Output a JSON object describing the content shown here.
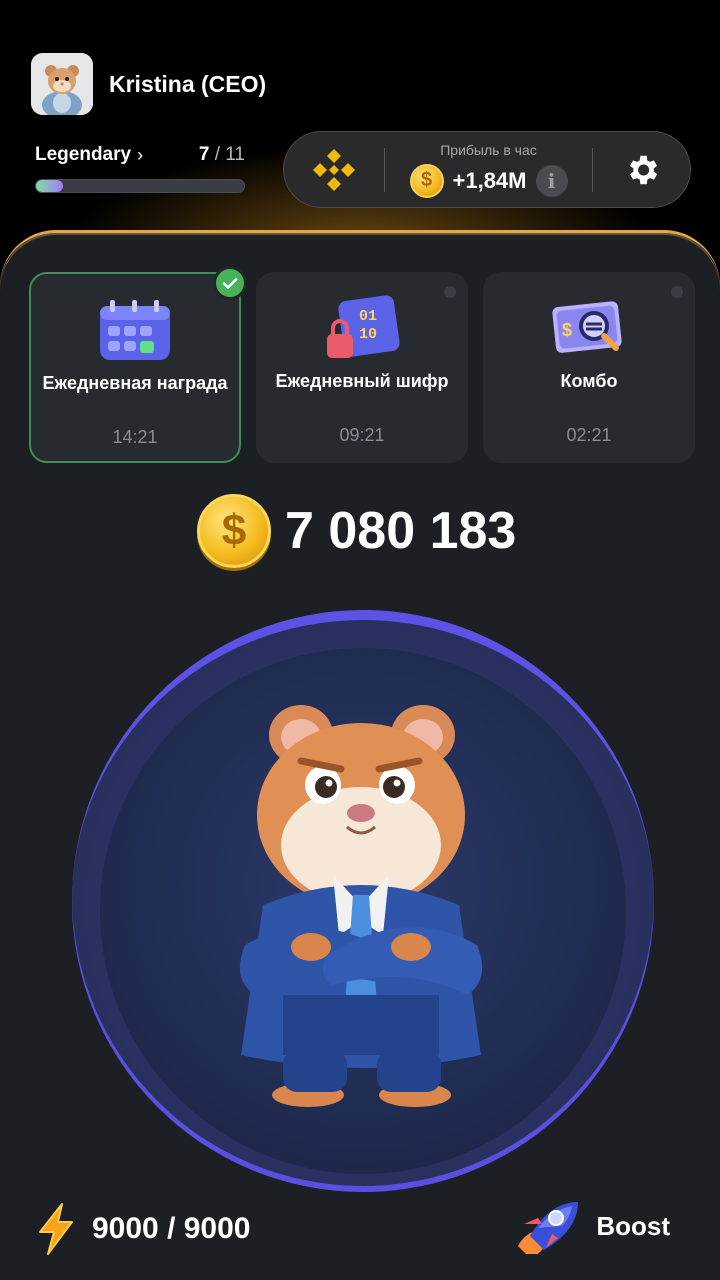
{
  "user": {
    "name": "Kristina (CEO)",
    "avatar_icon": "hamster-avatar-icon"
  },
  "level": {
    "name": "Legendary",
    "current": "7",
    "separator": "/",
    "total": "11",
    "progress": 0.13
  },
  "stats": {
    "exchange_icon": "binance-icon",
    "profit_label": "Прибыль в час",
    "profit_value": "+1,84M",
    "info_symbol": "i",
    "settings_icon": "gear-icon"
  },
  "cards": [
    {
      "title": "Ежедневная награда",
      "time": "14:21",
      "icon": "calendar-icon",
      "completed": true
    },
    {
      "title": "Ежедневный шифр",
      "time": "09:21",
      "icon": "cipher-lock-icon",
      "completed": false
    },
    {
      "title": "Комбо",
      "time": "02:21",
      "icon": "combo-magnifier-icon",
      "completed": false
    }
  ],
  "balance": {
    "value": "7 080 183",
    "coin_symbol": "$"
  },
  "energy": {
    "value": "9000 / 9000",
    "icon": "lightning-icon"
  },
  "boost": {
    "label": "Boost",
    "icon": "rocket-icon"
  },
  "colors": {
    "accent": "#e7a842",
    "panel": "#1c1f24",
    "card": "#272a2f",
    "tap_ring": "#5d51e6",
    "check": "#46b35a"
  }
}
